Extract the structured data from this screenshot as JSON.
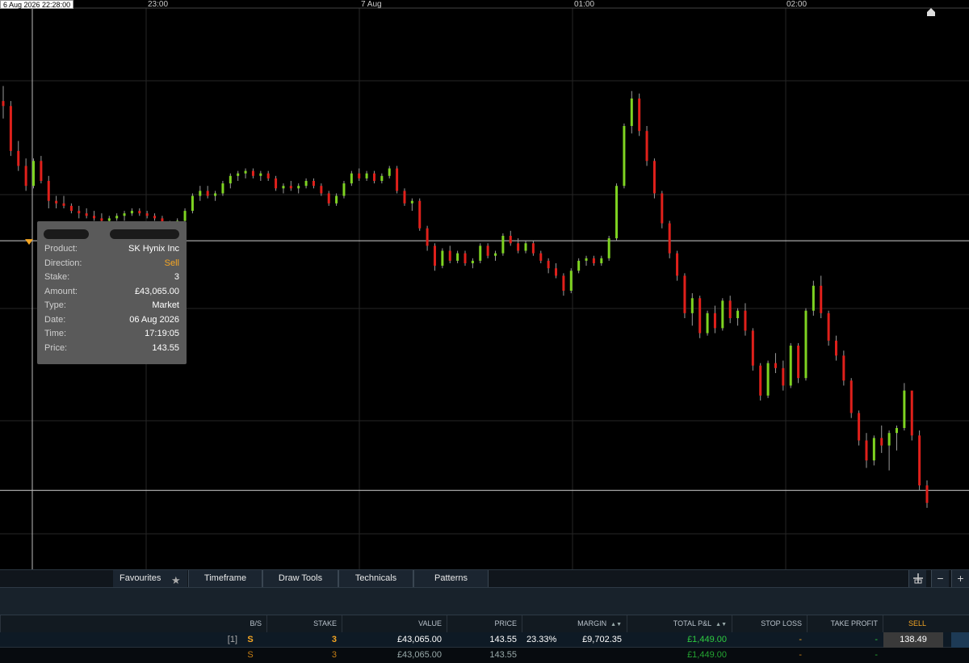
{
  "chart": {
    "crosshair_time": "6 Aug 2026 22:28:00",
    "time_axis": [
      "23:00",
      "7 Aug",
      "01:00",
      "02:00"
    ]
  },
  "chart_data": {
    "type": "candlestick",
    "instrument": "SK Hynix Inc",
    "candles": [
      [
        146.6,
        147.2,
        145.9,
        146.4
      ],
      [
        146.4,
        146.6,
        144.4,
        144.6
      ],
      [
        144.6,
        145.0,
        143.8,
        144.0
      ],
      [
        144.0,
        144.3,
        143.0,
        143.2
      ],
      [
        143.2,
        144.3,
        143.1,
        144.2
      ],
      [
        144.2,
        144.4,
        143.3,
        143.4
      ],
      [
        143.4,
        143.6,
        142.3,
        142.6
      ],
      [
        142.6,
        142.8,
        142.3,
        142.5
      ],
      [
        142.5,
        142.8,
        142.3,
        142.4
      ],
      [
        142.4,
        142.5,
        142.1,
        142.2
      ],
      [
        142.2,
        142.4,
        141.9,
        142.1
      ],
      [
        142.1,
        142.3,
        141.9,
        142.0
      ],
      [
        142.0,
        142.2,
        141.8,
        141.9
      ],
      [
        141.9,
        142.1,
        141.7,
        141.8
      ],
      [
        141.8,
        142.0,
        141.7,
        141.9
      ],
      [
        141.9,
        142.1,
        141.8,
        142.0
      ],
      [
        142.0,
        142.2,
        141.8,
        142.1
      ],
      [
        142.1,
        142.3,
        142.0,
        142.2
      ],
      [
        142.2,
        142.3,
        142.0,
        142.1
      ],
      [
        142.1,
        142.2,
        141.9,
        142.0
      ],
      [
        142.0,
        142.1,
        141.8,
        141.9
      ],
      [
        141.9,
        142.0,
        141.6,
        141.7
      ],
      [
        141.7,
        141.8,
        141.4,
        141.5
      ],
      [
        141.5,
        141.9,
        141.4,
        141.8
      ],
      [
        141.8,
        142.3,
        141.7,
        142.2
      ],
      [
        142.2,
        142.9,
        142.1,
        142.8
      ],
      [
        142.8,
        143.2,
        142.6,
        143.0
      ],
      [
        143.0,
        143.2,
        142.7,
        142.8
      ],
      [
        142.8,
        143.0,
        142.6,
        142.9
      ],
      [
        142.9,
        143.4,
        142.8,
        143.3
      ],
      [
        143.3,
        143.7,
        143.1,
        143.6
      ],
      [
        143.6,
        143.8,
        143.4,
        143.7
      ],
      [
        143.7,
        143.9,
        143.5,
        143.8
      ],
      [
        143.8,
        143.9,
        143.5,
        143.6
      ],
      [
        143.6,
        143.8,
        143.4,
        143.7
      ],
      [
        143.7,
        143.8,
        143.4,
        143.5
      ],
      [
        143.5,
        143.6,
        143.0,
        143.1
      ],
      [
        143.1,
        143.3,
        142.9,
        143.2
      ],
      [
        143.2,
        143.4,
        143.0,
        143.1
      ],
      [
        143.1,
        143.3,
        142.9,
        143.2
      ],
      [
        143.2,
        143.5,
        143.1,
        143.4
      ],
      [
        143.4,
        143.5,
        143.1,
        143.2
      ],
      [
        143.2,
        143.3,
        142.8,
        142.9
      ],
      [
        142.9,
        143.0,
        142.4,
        142.5
      ],
      [
        142.5,
        142.9,
        142.4,
        142.8
      ],
      [
        142.8,
        143.4,
        142.7,
        143.3
      ],
      [
        143.3,
        143.8,
        143.2,
        143.7
      ],
      [
        143.7,
        143.9,
        143.4,
        143.5
      ],
      [
        143.5,
        143.8,
        143.4,
        143.7
      ],
      [
        143.7,
        143.8,
        143.3,
        143.4
      ],
      [
        143.4,
        143.7,
        143.3,
        143.6
      ],
      [
        143.6,
        144.0,
        143.5,
        143.9
      ],
      [
        143.9,
        144.0,
        142.9,
        143.0
      ],
      [
        143.0,
        143.1,
        142.4,
        142.5
      ],
      [
        142.5,
        142.7,
        142.2,
        142.6
      ],
      [
        142.6,
        142.7,
        141.4,
        141.5
      ],
      [
        141.5,
        141.6,
        140.6,
        140.8
      ],
      [
        140.8,
        140.9,
        139.8,
        140.0
      ],
      [
        140.0,
        140.7,
        139.9,
        140.6
      ],
      [
        140.6,
        140.8,
        140.1,
        140.2
      ],
      [
        140.2,
        140.6,
        140.1,
        140.5
      ],
      [
        140.5,
        140.6,
        140.0,
        140.1
      ],
      [
        140.1,
        140.3,
        139.9,
        140.2
      ],
      [
        140.2,
        140.9,
        140.1,
        140.8
      ],
      [
        140.8,
        140.9,
        140.3,
        140.4
      ],
      [
        140.4,
        140.6,
        140.2,
        140.5
      ],
      [
        140.5,
        141.3,
        140.4,
        141.2
      ],
      [
        141.2,
        141.4,
        140.8,
        140.9
      ],
      [
        140.9,
        141.1,
        140.5,
        140.6
      ],
      [
        140.6,
        141.0,
        140.5,
        140.9
      ],
      [
        140.9,
        141.0,
        140.4,
        140.5
      ],
      [
        140.5,
        140.6,
        140.1,
        140.2
      ],
      [
        140.2,
        140.3,
        139.7,
        139.9
      ],
      [
        139.9,
        140.1,
        139.5,
        139.6
      ],
      [
        139.6,
        139.7,
        138.8,
        139.0
      ],
      [
        139.0,
        139.9,
        138.9,
        139.8
      ],
      [
        139.8,
        140.3,
        139.7,
        140.2
      ],
      [
        140.2,
        140.4,
        140.0,
        140.3
      ],
      [
        140.3,
        140.4,
        140.0,
        140.1
      ],
      [
        140.1,
        140.4,
        140.0,
        140.3
      ],
      [
        140.3,
        141.2,
        140.2,
        141.1
      ],
      [
        141.1,
        143.3,
        141.0,
        143.2
      ],
      [
        143.2,
        145.7,
        143.1,
        145.6
      ],
      [
        145.6,
        147.0,
        145.3,
        146.7
      ],
      [
        146.7,
        146.9,
        145.2,
        145.4
      ],
      [
        145.4,
        145.6,
        144.0,
        144.2
      ],
      [
        144.2,
        144.3,
        142.7,
        142.9
      ],
      [
        142.9,
        143.0,
        141.5,
        141.7
      ],
      [
        141.7,
        141.8,
        140.3,
        140.5
      ],
      [
        140.5,
        140.6,
        139.4,
        139.6
      ],
      [
        139.6,
        139.7,
        137.9,
        138.1
      ],
      [
        138.1,
        138.9,
        137.6,
        138.7
      ],
      [
        138.7,
        138.8,
        137.1,
        137.3
      ],
      [
        137.3,
        138.2,
        137.2,
        138.1
      ],
      [
        138.1,
        138.4,
        137.3,
        137.5
      ],
      [
        137.5,
        138.7,
        137.4,
        138.6
      ],
      [
        138.6,
        138.8,
        137.7,
        137.9
      ],
      [
        137.9,
        138.3,
        137.6,
        138.2
      ],
      [
        138.2,
        138.5,
        137.2,
        137.4
      ],
      [
        137.4,
        137.5,
        135.8,
        136.0
      ],
      [
        136.0,
        136.1,
        134.6,
        134.8
      ],
      [
        134.8,
        136.2,
        134.7,
        136.1
      ],
      [
        136.1,
        136.5,
        135.7,
        135.9
      ],
      [
        135.9,
        136.2,
        135.0,
        135.2
      ],
      [
        135.2,
        136.9,
        135.1,
        136.8
      ],
      [
        136.8,
        136.9,
        135.3,
        135.5
      ],
      [
        135.5,
        138.3,
        135.4,
        138.2
      ],
      [
        138.2,
        139.4,
        138.0,
        139.2
      ],
      [
        139.2,
        139.6,
        137.9,
        138.1
      ],
      [
        138.1,
        138.2,
        136.8,
        137.0
      ],
      [
        137.0,
        137.2,
        136.2,
        136.4
      ],
      [
        136.4,
        136.6,
        135.2,
        135.4
      ],
      [
        135.4,
        135.5,
        133.9,
        134.1
      ],
      [
        134.1,
        134.2,
        132.8,
        133.0
      ],
      [
        133.0,
        133.3,
        131.9,
        132.2
      ],
      [
        132.2,
        133.2,
        132.0,
        133.1
      ],
      [
        133.1,
        133.6,
        132.5,
        132.8
      ],
      [
        132.8,
        133.4,
        131.8,
        133.3
      ],
      [
        133.3,
        133.6,
        132.6,
        133.5
      ],
      [
        133.5,
        135.3,
        133.4,
        135.0
      ],
      [
        135.0,
        134.6,
        133.0,
        133.2
      ],
      [
        133.2,
        133.4,
        131.0,
        131.2
      ],
      [
        131.2,
        131.4,
        130.3,
        130.5
      ]
    ],
    "reference_lines": [
      141.0,
      131.0
    ],
    "ylim": [
      128.0,
      150.0
    ]
  },
  "tooltip": {
    "rows": [
      {
        "key": "Product:",
        "value": "SK Hynix Inc"
      },
      {
        "key": "Direction:",
        "value": "Sell"
      },
      {
        "key": "Stake:",
        "value": "3"
      },
      {
        "key": "Amount:",
        "value": "£43,065.00"
      },
      {
        "key": "Type:",
        "value": "Market"
      },
      {
        "key": "Date:",
        "value": "06 Aug 2026"
      },
      {
        "key": "Time:",
        "value": "17:19:05"
      },
      {
        "key": "Price:",
        "value": "143.55"
      }
    ]
  },
  "toolbar": {
    "favourites": "Favourites",
    "timeframe": "Timeframe",
    "draw_tools": "Draw Tools",
    "technicals": "Technicals",
    "patterns": "Patterns",
    "minus": "−",
    "plus": "+"
  },
  "positions": {
    "headers": {
      "bs": "B/S",
      "stake": "STAKE",
      "value": "VALUE",
      "price": "PRICE",
      "margin": "MARGIN",
      "total_pl": "TOTAL P&L",
      "stop_loss": "STOP LOSS",
      "take_profit": "TAKE PROFIT",
      "sell": "SELL"
    },
    "row1": {
      "count": "[1]",
      "bs": "S",
      "stake": "3",
      "value": "£43,065.00",
      "price": "143.55",
      "margin_pct": "23.33%",
      "margin": "£9,702.35",
      "total_pl": "£1,449.00",
      "stop_loss": "-",
      "take_profit": "-",
      "sell": "138.49"
    },
    "row2": {
      "bs": "S",
      "stake": "3",
      "value": "£43,065.00",
      "price": "143.55",
      "total_pl": "£1,449.00",
      "stop_loss": "-",
      "take_profit": "-"
    }
  },
  "colors": {
    "up": "#7ed321",
    "down": "#e0201b",
    "grid": "#2a2a2a",
    "accent": "#f5a623",
    "profit": "#2ecc40"
  }
}
